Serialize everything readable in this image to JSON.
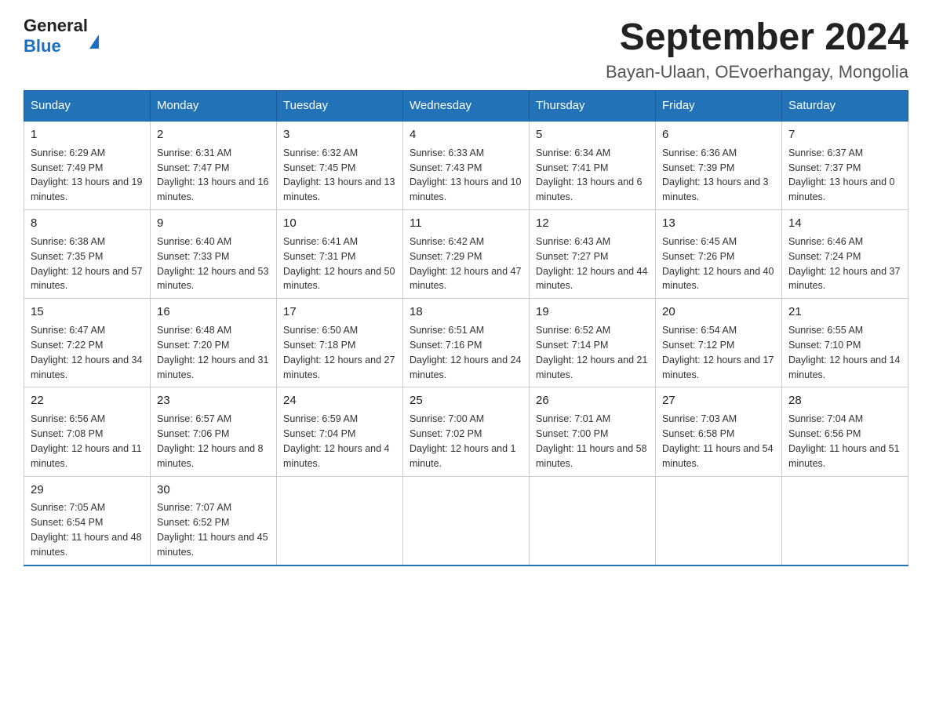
{
  "header": {
    "logo": {
      "general": "General",
      "blue": "Blue"
    },
    "title": "September 2024",
    "location": "Bayan-Ulaan, OEvoerhangay, Mongolia"
  },
  "days_of_week": [
    "Sunday",
    "Monday",
    "Tuesday",
    "Wednesday",
    "Thursday",
    "Friday",
    "Saturday"
  ],
  "weeks": [
    [
      {
        "day": "1",
        "sunrise": "6:29 AM",
        "sunset": "7:49 PM",
        "daylight": "13 hours and 19 minutes."
      },
      {
        "day": "2",
        "sunrise": "6:31 AM",
        "sunset": "7:47 PM",
        "daylight": "13 hours and 16 minutes."
      },
      {
        "day": "3",
        "sunrise": "6:32 AM",
        "sunset": "7:45 PM",
        "daylight": "13 hours and 13 minutes."
      },
      {
        "day": "4",
        "sunrise": "6:33 AM",
        "sunset": "7:43 PM",
        "daylight": "13 hours and 10 minutes."
      },
      {
        "day": "5",
        "sunrise": "6:34 AM",
        "sunset": "7:41 PM",
        "daylight": "13 hours and 6 minutes."
      },
      {
        "day": "6",
        "sunrise": "6:36 AM",
        "sunset": "7:39 PM",
        "daylight": "13 hours and 3 minutes."
      },
      {
        "day": "7",
        "sunrise": "6:37 AM",
        "sunset": "7:37 PM",
        "daylight": "13 hours and 0 minutes."
      }
    ],
    [
      {
        "day": "8",
        "sunrise": "6:38 AM",
        "sunset": "7:35 PM",
        "daylight": "12 hours and 57 minutes."
      },
      {
        "day": "9",
        "sunrise": "6:40 AM",
        "sunset": "7:33 PM",
        "daylight": "12 hours and 53 minutes."
      },
      {
        "day": "10",
        "sunrise": "6:41 AM",
        "sunset": "7:31 PM",
        "daylight": "12 hours and 50 minutes."
      },
      {
        "day": "11",
        "sunrise": "6:42 AM",
        "sunset": "7:29 PM",
        "daylight": "12 hours and 47 minutes."
      },
      {
        "day": "12",
        "sunrise": "6:43 AM",
        "sunset": "7:27 PM",
        "daylight": "12 hours and 44 minutes."
      },
      {
        "day": "13",
        "sunrise": "6:45 AM",
        "sunset": "7:26 PM",
        "daylight": "12 hours and 40 minutes."
      },
      {
        "day": "14",
        "sunrise": "6:46 AM",
        "sunset": "7:24 PM",
        "daylight": "12 hours and 37 minutes."
      }
    ],
    [
      {
        "day": "15",
        "sunrise": "6:47 AM",
        "sunset": "7:22 PM",
        "daylight": "12 hours and 34 minutes."
      },
      {
        "day": "16",
        "sunrise": "6:48 AM",
        "sunset": "7:20 PM",
        "daylight": "12 hours and 31 minutes."
      },
      {
        "day": "17",
        "sunrise": "6:50 AM",
        "sunset": "7:18 PM",
        "daylight": "12 hours and 27 minutes."
      },
      {
        "day": "18",
        "sunrise": "6:51 AM",
        "sunset": "7:16 PM",
        "daylight": "12 hours and 24 minutes."
      },
      {
        "day": "19",
        "sunrise": "6:52 AM",
        "sunset": "7:14 PM",
        "daylight": "12 hours and 21 minutes."
      },
      {
        "day": "20",
        "sunrise": "6:54 AM",
        "sunset": "7:12 PM",
        "daylight": "12 hours and 17 minutes."
      },
      {
        "day": "21",
        "sunrise": "6:55 AM",
        "sunset": "7:10 PM",
        "daylight": "12 hours and 14 minutes."
      }
    ],
    [
      {
        "day": "22",
        "sunrise": "6:56 AM",
        "sunset": "7:08 PM",
        "daylight": "12 hours and 11 minutes."
      },
      {
        "day": "23",
        "sunrise": "6:57 AM",
        "sunset": "7:06 PM",
        "daylight": "12 hours and 8 minutes."
      },
      {
        "day": "24",
        "sunrise": "6:59 AM",
        "sunset": "7:04 PM",
        "daylight": "12 hours and 4 minutes."
      },
      {
        "day": "25",
        "sunrise": "7:00 AM",
        "sunset": "7:02 PM",
        "daylight": "12 hours and 1 minute."
      },
      {
        "day": "26",
        "sunrise": "7:01 AM",
        "sunset": "7:00 PM",
        "daylight": "11 hours and 58 minutes."
      },
      {
        "day": "27",
        "sunrise": "7:03 AM",
        "sunset": "6:58 PM",
        "daylight": "11 hours and 54 minutes."
      },
      {
        "day": "28",
        "sunrise": "7:04 AM",
        "sunset": "6:56 PM",
        "daylight": "11 hours and 51 minutes."
      }
    ],
    [
      {
        "day": "29",
        "sunrise": "7:05 AM",
        "sunset": "6:54 PM",
        "daylight": "11 hours and 48 minutes."
      },
      {
        "day": "30",
        "sunrise": "7:07 AM",
        "sunset": "6:52 PM",
        "daylight": "11 hours and 45 minutes."
      },
      null,
      null,
      null,
      null,
      null
    ]
  ],
  "labels": {
    "sunrise": "Sunrise:",
    "sunset": "Sunset:",
    "daylight": "Daylight:"
  }
}
